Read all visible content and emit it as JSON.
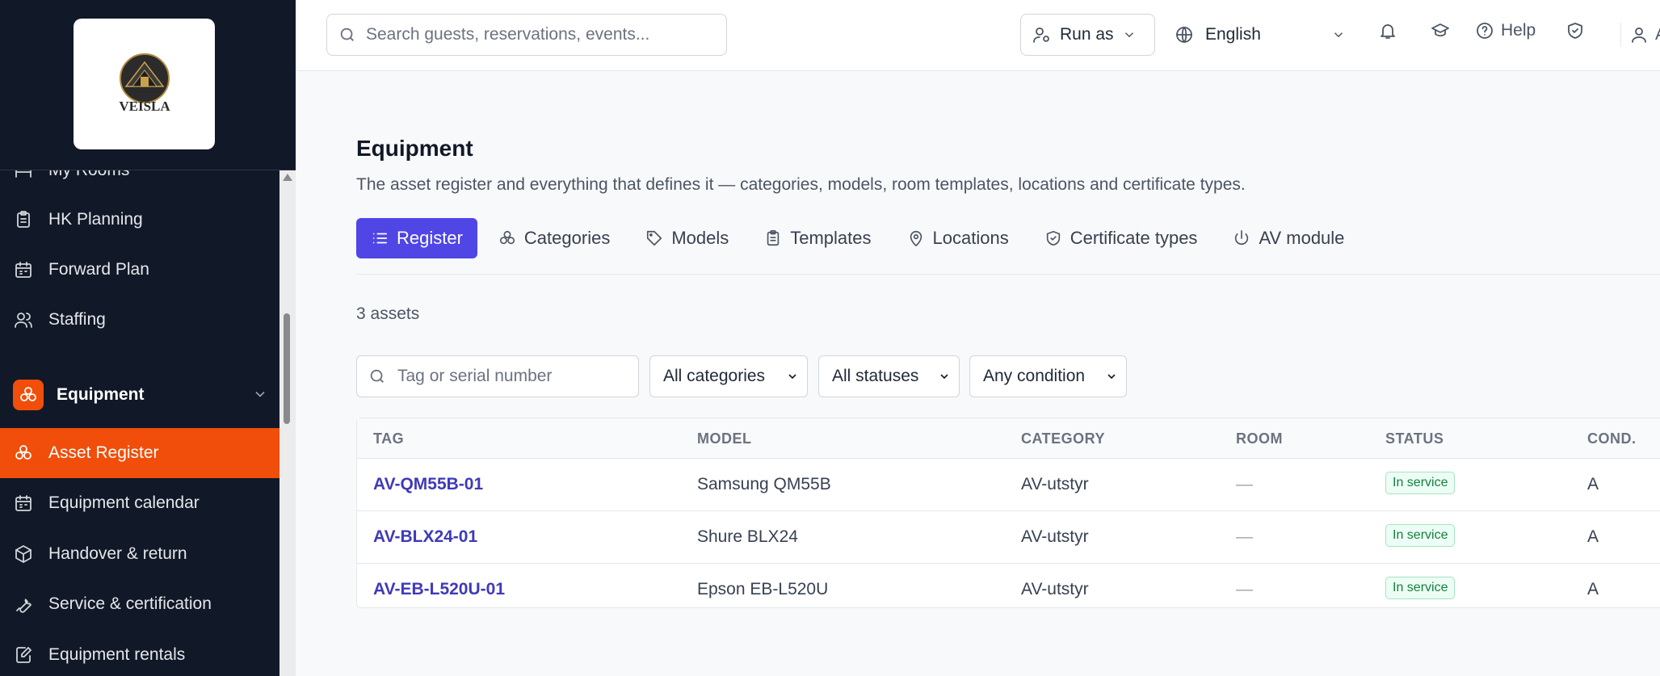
{
  "sidebar": {
    "logo_text": "VEISLA",
    "items_top": [
      {
        "label": "My Rooms",
        "icon": "bed-icon"
      },
      {
        "label": "HK Planning",
        "icon": "clipboard-icon"
      },
      {
        "label": "Forward Plan",
        "icon": "calendar-icon"
      },
      {
        "label": "Staffing",
        "icon": "users-icon"
      }
    ],
    "group": {
      "label": "Equipment",
      "icon": "equipment-icon"
    },
    "items_equipment": [
      {
        "label": "Asset Register",
        "icon": "equipment-icon",
        "active": true
      },
      {
        "label": "Equipment calendar",
        "icon": "calendar-icon"
      },
      {
        "label": "Handover & return",
        "icon": "package-icon"
      },
      {
        "label": "Service & certification",
        "icon": "wrench-icon"
      },
      {
        "label": "Equipment rentals",
        "icon": "file-edit-icon"
      }
    ]
  },
  "topbar": {
    "search_placeholder": "Search guests, reservations, events...",
    "run_as_label": "Run as",
    "language": "English",
    "help_label": "Help",
    "account_label": "A"
  },
  "page": {
    "title": "Equipment",
    "description": "The asset register and everything that defines it — categories, models, room templates, locations and certificate types.",
    "tabs": [
      {
        "label": "Register",
        "icon": "list-icon",
        "active": true
      },
      {
        "label": "Categories",
        "icon": "equipment-icon"
      },
      {
        "label": "Models",
        "icon": "tag-icon"
      },
      {
        "label": "Templates",
        "icon": "clipboard-icon"
      },
      {
        "label": "Locations",
        "icon": "map-pin-icon"
      },
      {
        "label": "Certificate types",
        "icon": "shield-check-icon"
      },
      {
        "label": "AV module",
        "icon": "power-icon"
      }
    ],
    "asset_count": "3 assets"
  },
  "filters": {
    "search_placeholder": "Tag or serial number",
    "category": "All categories",
    "status": "All statuses",
    "condition": "Any condition"
  },
  "table": {
    "columns": [
      "TAG",
      "MODEL",
      "CATEGORY",
      "ROOM",
      "STATUS",
      "COND."
    ],
    "rows": [
      {
        "tag": "AV-QM55B-01",
        "model": "Samsung QM55B",
        "category": "AV-utstyr",
        "room": "—",
        "status": "In service",
        "cond": "A"
      },
      {
        "tag": "AV-BLX24-01",
        "model": "Shure BLX24",
        "category": "AV-utstyr",
        "room": "—",
        "status": "In service",
        "cond": "A"
      },
      {
        "tag": "AV-EB-L520U-01",
        "model": "Epson EB-L520U",
        "category": "AV-utstyr",
        "room": "—",
        "status": "In service",
        "cond": "A"
      }
    ]
  },
  "colors": {
    "sidebar_bg": "#111827",
    "accent_orange": "#f04e0a",
    "accent_indigo": "#4f46e5",
    "link": "#3f3ab8",
    "status_green": "#15803d"
  }
}
